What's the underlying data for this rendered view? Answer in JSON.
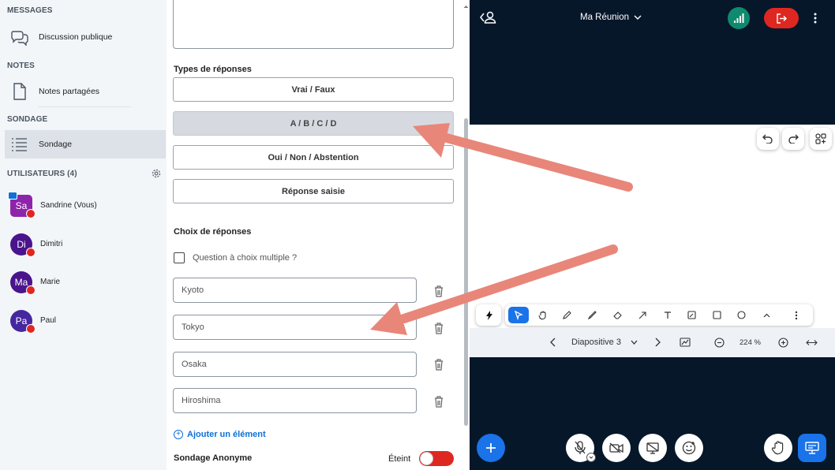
{
  "sidebar": {
    "sections": {
      "messages": "MESSAGES",
      "notes": "NOTES",
      "poll": "SONDAGE",
      "users": "UTILISATEURS (4)"
    },
    "items": [
      {
        "label": "Discussion publique",
        "icon": "chat-bubbles-icon"
      },
      {
        "label": "Notes partagées",
        "icon": "notes-document-icon"
      },
      {
        "label": "Sondage",
        "icon": "poll-list-icon",
        "active": true
      }
    ],
    "users": [
      {
        "initials": "Sa",
        "name": "Sandrine (Vous)",
        "color": "#8e24aa"
      },
      {
        "initials": "Di",
        "name": "Dimitri",
        "color": "#4a148c"
      },
      {
        "initials": "Ma",
        "name": "Marie",
        "color": "#4a148c"
      },
      {
        "initials": "Pa",
        "name": "Paul",
        "color": "#4527a0"
      }
    ]
  },
  "poll": {
    "response_types_title": "Types de réponses",
    "response_types": [
      "Vrai / Faux",
      "A / B / C / D",
      "Oui / Non / Abstention",
      "Réponse saisie"
    ],
    "selected_type": "A / B / C / D",
    "choices_title": "Choix de réponses",
    "multiple_choice_label": "Question à choix multiple ?",
    "options": [
      "Kyoto",
      "Tokyo",
      "Osaka",
      "Hiroshima"
    ],
    "add_item_label": "Ajouter un élément",
    "anonymous_label": "Sondage Anonyme",
    "anonymous_state": "Éteint"
  },
  "meeting": {
    "title": "Ma Réunion",
    "slide_label": "Diapositive 3",
    "zoom": "224 %",
    "colors": {
      "background": "#06172a",
      "accent_blue": "#1a73e8",
      "leave_red": "#df2721",
      "connection_green": "#0f8a6e",
      "annotation_arrow": "#e8867a"
    }
  }
}
